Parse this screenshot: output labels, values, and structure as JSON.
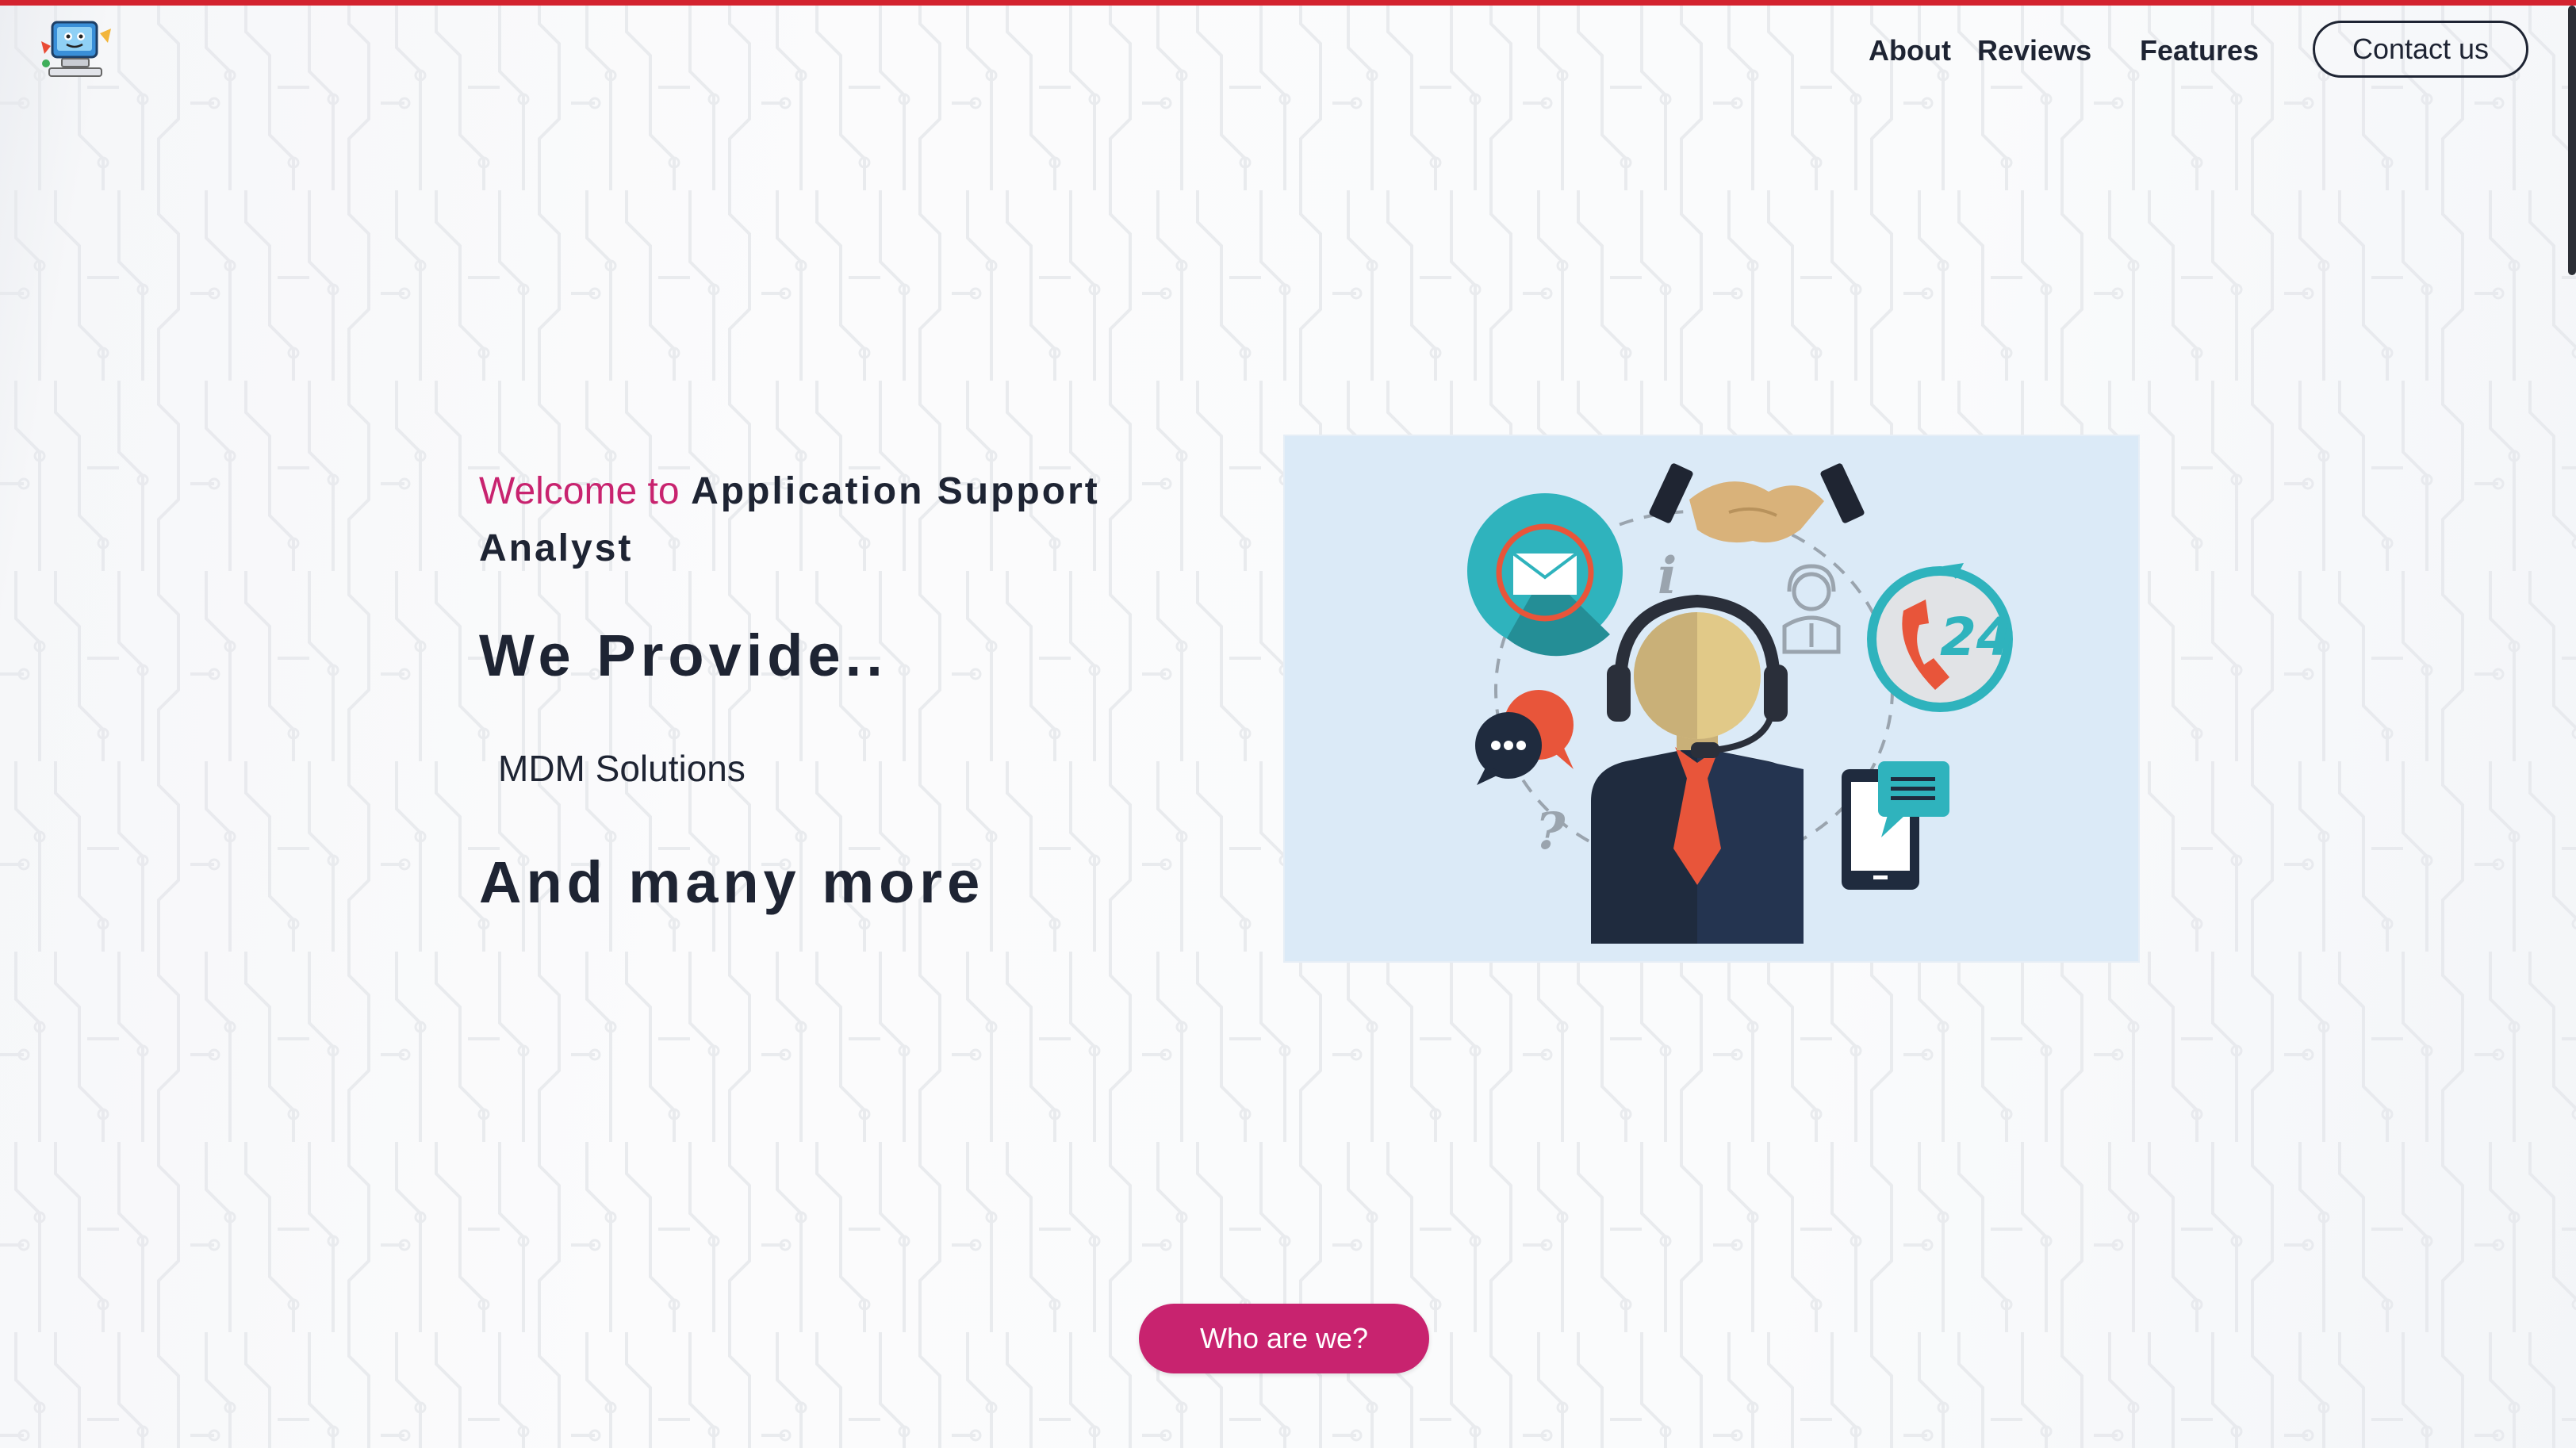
{
  "nav": {
    "about": "About",
    "reviews": "Reviews",
    "features": "Features",
    "contact": "Contact us"
  },
  "hero": {
    "welcome_prefix": "Welcome to",
    "welcome_title": "Application Support Analyst",
    "provide_heading": "We Provide..",
    "service_text": "MDM Solutions",
    "more_heading": "And many more"
  },
  "illustration": {
    "badge_24": "24"
  },
  "cta": {
    "who_label": "Who are we?"
  },
  "colors": {
    "top_bar": "#d3232f",
    "accent_pink": "#c8236f",
    "text_dark": "#1e2433",
    "illustration_bg": "#dbeaf7"
  }
}
